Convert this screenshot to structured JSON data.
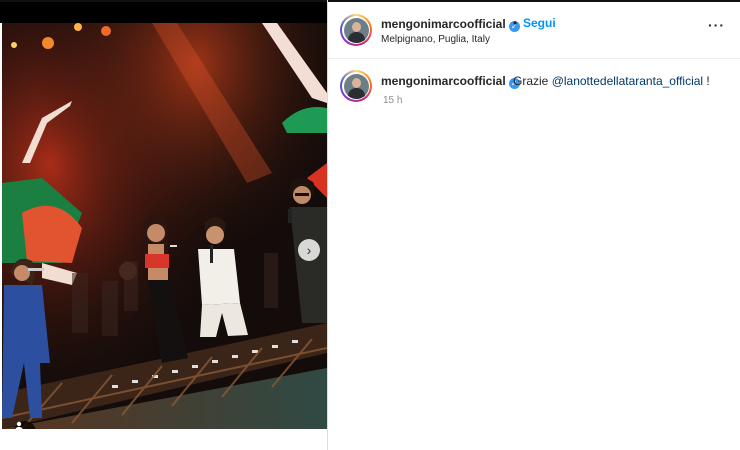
{
  "post": {
    "username": "mengonimarcoofficial",
    "verified": true,
    "separator": "•",
    "follow_label": "Segui",
    "location": "Melpignano, Puglia, Italy",
    "more_icon": "more-options-icon"
  },
  "caption": {
    "username": "mengonimarcoofficial",
    "text_before": "Grazie ",
    "mention": "@lanottedellataranta_official",
    "text_after": " !",
    "time": "15 h"
  },
  "carousel": {
    "slide_count": 2,
    "active_index": 0,
    "next_icon": "chevron-right-icon",
    "next_glyph": "›",
    "tag_icon": "user-tag-icon"
  },
  "colors": {
    "link_blue": "#0095f6",
    "mention_blue": "#00376b",
    "verified_blue": "#3897f0",
    "muted": "#8e8e8e"
  }
}
